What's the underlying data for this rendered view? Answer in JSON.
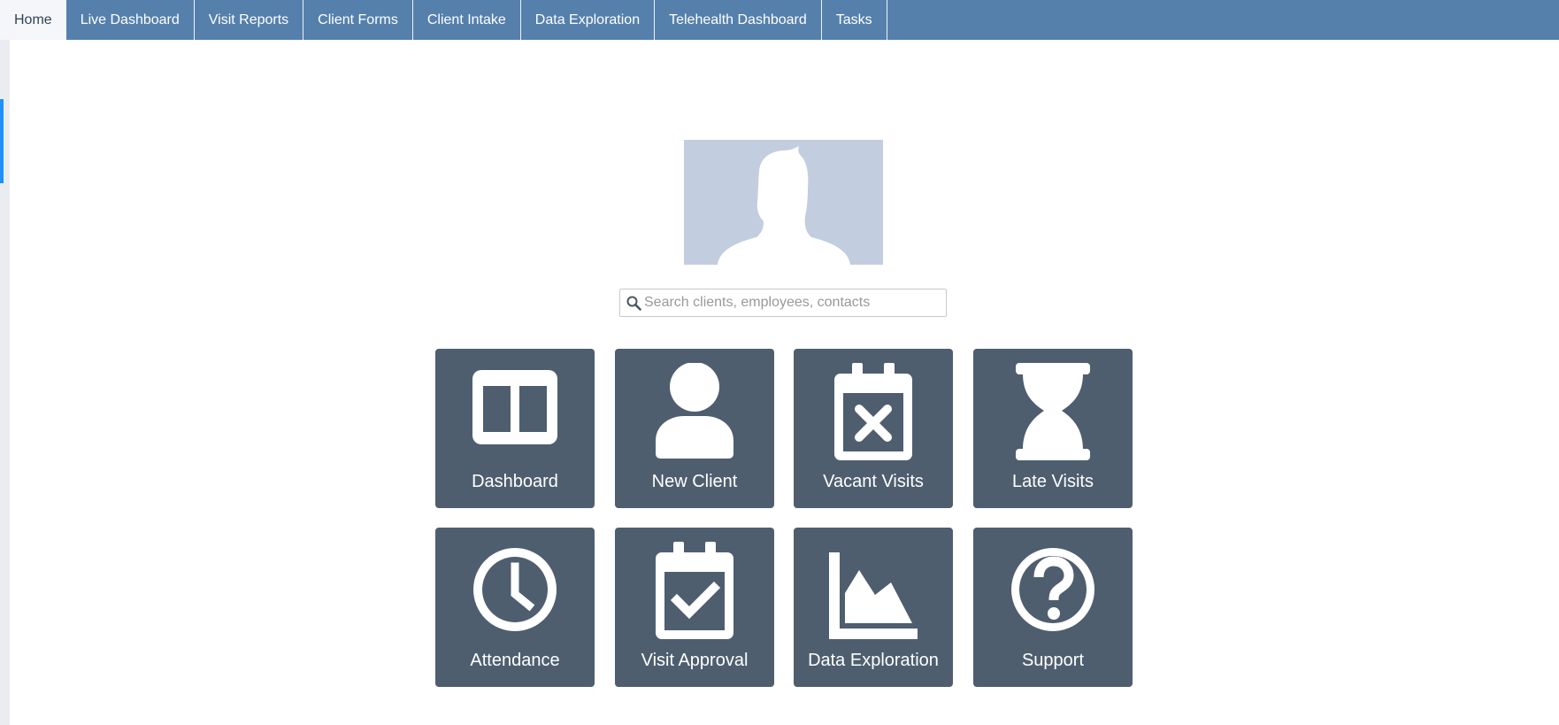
{
  "nav": {
    "tabs": [
      {
        "label": "Home",
        "active": true
      },
      {
        "label": "Live Dashboard"
      },
      {
        "label": "Visit Reports"
      },
      {
        "label": "Client Forms"
      },
      {
        "label": "Client Intake"
      },
      {
        "label": "Data Exploration"
      },
      {
        "label": "Telehealth Dashboard"
      },
      {
        "label": "Tasks"
      }
    ]
  },
  "search": {
    "placeholder": "Search clients, employees, contacts",
    "value": ""
  },
  "tiles": [
    {
      "label": "Dashboard",
      "icon": "dashboard-columns-icon"
    },
    {
      "label": "New Client",
      "icon": "user-icon"
    },
    {
      "label": "Vacant Visits",
      "icon": "calendar-x-icon"
    },
    {
      "label": "Late Visits",
      "icon": "hourglass-icon"
    },
    {
      "label": "Attendance",
      "icon": "clock-icon"
    },
    {
      "label": "Visit Approval",
      "icon": "calendar-check-icon"
    },
    {
      "label": "Data Exploration",
      "icon": "area-chart-icon"
    },
    {
      "label": "Support",
      "icon": "question-circle-icon"
    }
  ],
  "colors": {
    "nav_bg": "#5580ac",
    "tile_bg": "#4e5e6f",
    "avatar_bg": "#c3cde0",
    "accent": "#1e90ff"
  }
}
